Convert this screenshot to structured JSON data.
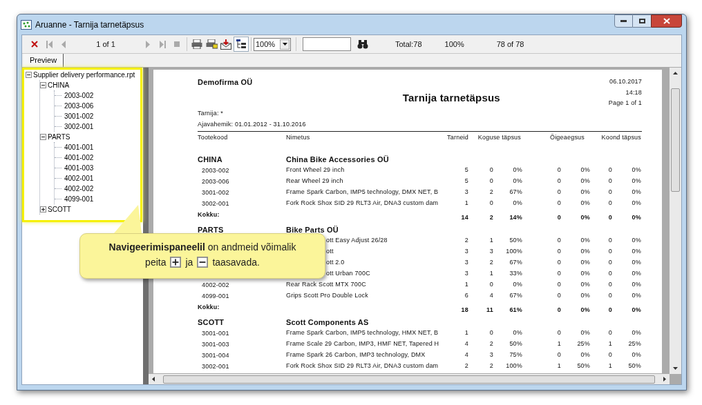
{
  "window": {
    "title": "Aruanne - Tarnija tarnetäpsus"
  },
  "toolbar": {
    "page": "1 of 1",
    "zoom": "100%",
    "total": "Total:78",
    "percent": "100%",
    "count": "78 of 78",
    "tree_toggle": {
      "on": true
    }
  },
  "tabs": [
    {
      "label": "Preview",
      "selected": true
    }
  ],
  "tree": {
    "label": "Supplier delivery performance.rpt",
    "expanded": true,
    "children": [
      {
        "label": "CHINA",
        "expanded": true,
        "children": [
          {
            "label": "2003-002"
          },
          {
            "label": "2003-006"
          },
          {
            "label": "3001-002"
          },
          {
            "label": "3002-001"
          }
        ]
      },
      {
        "label": "PARTS",
        "expanded": true,
        "children": [
          {
            "label": "4001-001"
          },
          {
            "label": "4001-002"
          },
          {
            "label": "4001-003"
          },
          {
            "label": "4002-001"
          },
          {
            "label": "4002-002"
          },
          {
            "label": "4099-001"
          }
        ]
      },
      {
        "label": "SCOTT",
        "expanded": false
      }
    ]
  },
  "report": {
    "company": "Demofirma OÜ",
    "title": "Tarnija tarnetäpsus",
    "date": "06.10.2017",
    "time": "14:18",
    "page": "Page 1 of 1",
    "filter_supplier": "Tarnija: *",
    "filter_period": "Ajavahemik: 01.01.2012 - 31.10.2016",
    "columns": [
      "Tootekood",
      "Nimetus",
      "Tarneid",
      "Koguse täpsus",
      "Õigeaegsus",
      "Koond täpsus"
    ],
    "groups": [
      {
        "code": "CHINA",
        "name": "China Bike Accessories OÜ",
        "rows": [
          {
            "kind": "full",
            "code": "2003-002",
            "name": "Front Wheel 29 inch",
            "values": [
              "5",
              "0",
              "0%",
              "0",
              "0%",
              "0",
              "0%"
            ]
          },
          {
            "kind": "full",
            "code": "2003-006",
            "name": "Rear Wheel 29 inch",
            "values": [
              "5",
              "0",
              "0%",
              "0",
              "0%",
              "0",
              "0%"
            ]
          },
          {
            "kind": "full",
            "code": "3001-002",
            "name": "Frame Spark Carbon, IMP5 technology, DMX NET, B",
            "values": [
              "3",
              "2",
              "67%",
              "0",
              "0%",
              "0",
              "0%"
            ]
          },
          {
            "kind": "full",
            "code": "3002-001",
            "name": "Fork Rock Shox SID 29 RLT3 Air, DNA3 custom dam",
            "values": [
              "1",
              "0",
              "0%",
              "0",
              "0%",
              "0",
              "0%"
            ]
          }
        ],
        "total_label": "Kokku:",
        "totals": [
          "14",
          "2",
          "14%",
          "0",
          "0%",
          "0",
          "0%"
        ]
      },
      {
        "code": "PARTS",
        "name": "Bike Parts OÜ",
        "rows": [
          {
            "kind": "covered",
            "name": "ott Easy Adjust 26/28",
            "values": [
              "2",
              "1",
              "50%",
              "0",
              "0%",
              "0",
              "0%"
            ]
          },
          {
            "kind": "covered",
            "name": "ott",
            "values": [
              "3",
              "3",
              "100%",
              "0",
              "0%",
              "0",
              "0%"
            ]
          },
          {
            "kind": "covered",
            "name": "ott 2.0",
            "values": [
              "3",
              "2",
              "67%",
              "0",
              "0%",
              "0",
              "0%"
            ]
          },
          {
            "kind": "covered",
            "name": "ott Urban 700C",
            "values": [
              "3",
              "1",
              "33%",
              "0",
              "0%",
              "0",
              "0%"
            ]
          },
          {
            "kind": "full",
            "code": "4002-002",
            "name": "Rear Rack Scott MTX 700C",
            "values": [
              "1",
              "0",
              "0%",
              "0",
              "0%",
              "0",
              "0%"
            ]
          },
          {
            "kind": "full",
            "code": "4099-001",
            "name": "Grips Scott Pro Double Lock",
            "values": [
              "6",
              "4",
              "67%",
              "0",
              "0%",
              "0",
              "0%"
            ]
          }
        ],
        "total_label": "Kokku:",
        "totals": [
          "18",
          "11",
          "61%",
          "0",
          "0%",
          "0",
          "0%"
        ]
      },
      {
        "code": "SCOTT",
        "name": "Scott Components AS",
        "rows": [
          {
            "kind": "full",
            "code": "3001-001",
            "name": "Frame Spark Carbon, IMP5 technology, HMX NET, B",
            "values": [
              "1",
              "0",
              "0%",
              "0",
              "0%",
              "0",
              "0%"
            ]
          },
          {
            "kind": "full",
            "code": "3001-003",
            "name": "Frame Scale 29 Carbon, IMP3, HMF NET, Tapered H",
            "values": [
              "4",
              "2",
              "50%",
              "1",
              "25%",
              "1",
              "25%"
            ]
          },
          {
            "kind": "full",
            "code": "3001-004",
            "name": "Frame Spark 26 Carbon, IMP3 technology, DMX",
            "values": [
              "4",
              "3",
              "75%",
              "0",
              "0%",
              "0",
              "0%"
            ]
          },
          {
            "kind": "full",
            "code": "3002-001",
            "name": "Fork Rock Shox SID 29 RLT3 Air, DNA3 custom dam",
            "values": [
              "2",
              "2",
              "100%",
              "1",
              "50%",
              "1",
              "50%"
            ]
          }
        ]
      }
    ]
  },
  "callout": {
    "line1": "**Navigeerimispaneelil** on andmeid võimalik",
    "word1": "peita",
    "word2": "ja",
    "word3": "taasavada."
  }
}
